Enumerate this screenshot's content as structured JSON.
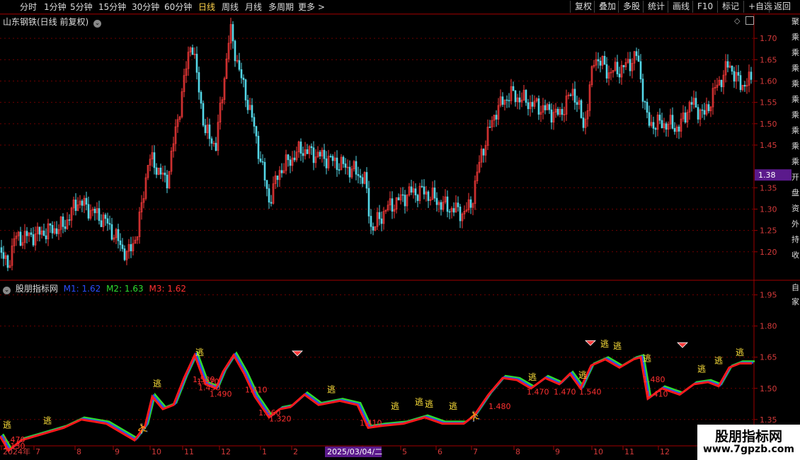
{
  "toolbar": {
    "periods": [
      "分时",
      "1分钟",
      "5分钟",
      "15分钟",
      "30分钟",
      "60分钟",
      "日线",
      "周线",
      "月线",
      "多周期",
      "更多 >"
    ],
    "active_period": "日线",
    "right_buttons": [
      "复权",
      "叠加",
      "多股",
      "统计",
      "画线",
      "F10",
      "标记",
      "+自选",
      "返回"
    ]
  },
  "main_chart": {
    "title": "山东钢铁(日线 前复权)",
    "price_ticks": [
      "1.70",
      "1.65",
      "1.60",
      "1.55",
      "1.50",
      "1.45",
      "1.35",
      "1.30",
      "1.25",
      "1.20"
    ],
    "current_price": "1.38",
    "price_range": [
      1.14,
      1.75
    ],
    "colors": {
      "up": "#ff3b3b",
      "down": "#54d8e8",
      "grid": "#6e0000",
      "axis": "#a00000",
      "current_bg": "#5b1a8c"
    }
  },
  "indicator": {
    "name": "股朋指标网",
    "m1_label": "M1: 1.62",
    "m2_label": "M2: 1.63",
    "m3_label": "M3: 1.62",
    "ticks": [
      "1.95",
      "1.80",
      "1.65",
      "1.50",
      "1.35"
    ],
    "range": [
      1.23,
      2.0
    ],
    "colors": {
      "m1": "#2a4dff",
      "m2": "#2fdc2f",
      "m3": "#ff1a1a",
      "signal": "#ffe23b",
      "price_label": "#ff3030"
    },
    "escape_char": "逃",
    "price_labels": [
      "1.470",
      "1.130",
      "1.530",
      "1.570",
      "1.450",
      "1.490",
      "1.410",
      "1.360",
      "1.320",
      "1.410",
      "1.480",
      "1.470",
      "1.470",
      "1.540",
      "1.480",
      "1.410"
    ]
  },
  "time_axis": {
    "labels": [
      "2024年",
      "7",
      "8",
      "9",
      "10",
      "11",
      "12",
      "1",
      "2",
      "3",
      "4",
      "5",
      "6",
      "7",
      "8",
      "9",
      "10",
      "11",
      "12"
    ],
    "cursor_date": "2025/03/04/二"
  },
  "side_text": [
    "聚",
    "乘",
    "乘",
    "乘",
    "乘",
    "乘",
    "乘",
    "乘",
    "乘",
    "乘",
    "开",
    "盘",
    "资",
    "外",
    "持",
    "收"
  ],
  "side_text2": [
    "自",
    "家"
  ],
  "watermark": {
    "title": "股朋指标网",
    "url": "www.7gpzb.com"
  }
}
